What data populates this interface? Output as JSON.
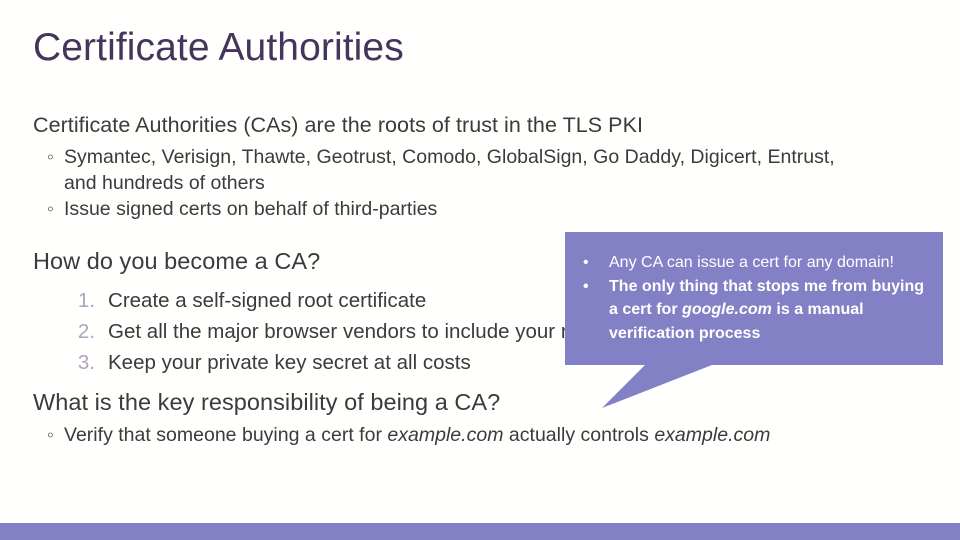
{
  "slide": {
    "title": "Certificate Authorities",
    "theme": {
      "title_color": "#46355a",
      "body_color": "#3b3b3b",
      "accent_purple": "#8381c6",
      "number_marker_color": "#b3a2bd",
      "background": "#fffffe"
    }
  },
  "intro": {
    "heading": "Certificate Authorities (CAs) are the roots of trust in the TLS PKI",
    "bullets": [
      {
        "marker": "◦",
        "line1": "Symantec, Verisign, Thawte, Geotrust, Comodo, GlobalSign, Go Daddy, Digicert, Entrust,",
        "line2": "and hundreds of others"
      },
      {
        "marker": "◦",
        "line1": "Issue signed certs on behalf of third-parties",
        "line2": ""
      }
    ]
  },
  "become": {
    "heading": "How do you become a CA?",
    "steps": [
      {
        "number": "1.",
        "text": "Create a self-signed root certificate"
      },
      {
        "number": "2.",
        "text": "Get all the major browser vendors to include your root"
      },
      {
        "number": "3.",
        "text": "Keep your private key secret at all costs"
      }
    ]
  },
  "key_responsibility": {
    "heading": "What is the key responsibility of being a CA?",
    "bullet": {
      "marker": "◦",
      "prefix": "Verify that someone buying a cert for ",
      "domain1": "example.com",
      "middle": " actually controls ",
      "domain2": "example.com"
    }
  },
  "callout": {
    "bullet_glyph": "•",
    "items": [
      {
        "bold": false,
        "text": "Any CA can issue a cert for any domain!"
      },
      {
        "bold": true,
        "prefix": "The only thing that stops me from buying a cert for ",
        "emphasis": "google.com",
        "suffix": " is a manual verification process"
      }
    ]
  }
}
